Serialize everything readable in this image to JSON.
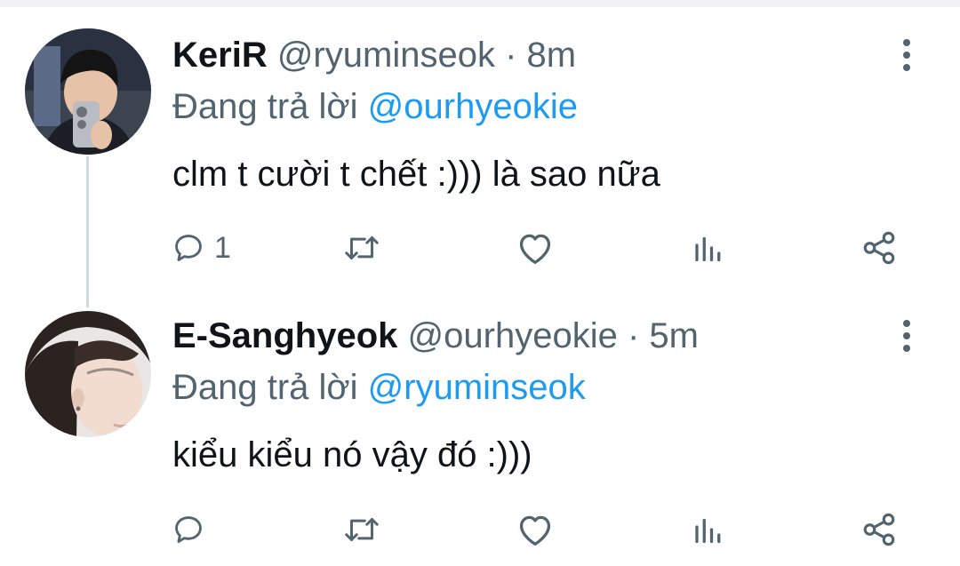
{
  "tweets": [
    {
      "display_name": "KeriR",
      "handle": "@ryuminseok",
      "separator": "·",
      "time": "8m",
      "reply_prefix": "Đang trả lời",
      "reply_to": "@ourhyeokie",
      "text": "clm t cười t chết :))) là sao nữa",
      "reply_count": "1",
      "icons": [
        "reply-icon",
        "retweet-icon",
        "like-icon",
        "analytics-icon",
        "share-icon",
        "more-icon"
      ]
    },
    {
      "display_name": "E-Sanghyeok",
      "handle": "@ourhyeokie",
      "separator": "·",
      "time": "5m",
      "reply_prefix": "Đang trả lời",
      "reply_to": "@ryuminseok",
      "text": "kiểu kiểu nó vậy đó :)))",
      "reply_count": "",
      "icons": [
        "reply-icon",
        "retweet-icon",
        "like-icon",
        "analytics-icon",
        "share-icon",
        "more-icon"
      ]
    }
  ],
  "colors": {
    "text_primary": "#0f1419",
    "text_secondary": "#536471",
    "link": "#1d9bf0",
    "thread_line": "#cfd9de"
  }
}
